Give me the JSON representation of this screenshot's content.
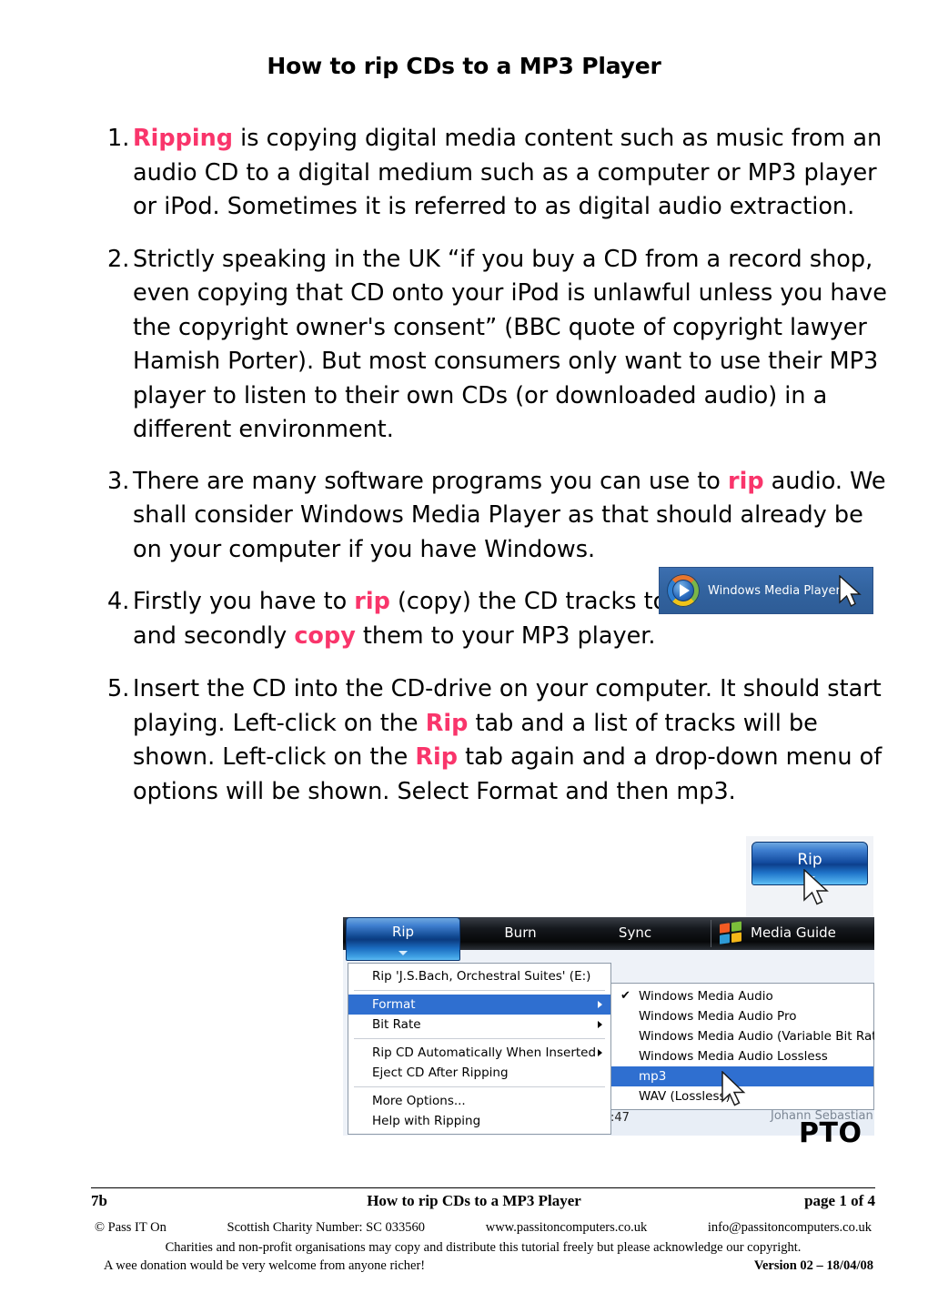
{
  "document": {
    "title": "How to rip CDs to a MP3 Player",
    "accent_pink": "#f9356b"
  },
  "items": [
    {
      "num": "1.",
      "pre": "",
      "emph": "Ripping",
      "post": " is copying digital media content such as music from an audio CD to a digital medium such as a computer or MP3 player or iPod. Sometimes it is referred to as digital audio extraction."
    },
    {
      "num": "2.",
      "text": "Strictly speaking in the UK “if you buy a CD from a record shop, even copying that CD onto your iPod is unlawful unless you have the copyright owner's consent” (BBC quote of copyright lawyer Hamish Porter). But most consumers only want to use their MP3 player to listen to their own CDs (or downloaded audio) in a different environment."
    },
    {
      "num": "3.",
      "pre": "There are many software programs you can use to ",
      "emph": "rip",
      "post": " audio. We shall consider Windows Media Player as that should already be on your computer if you have Windows."
    },
    {
      "num": "4.",
      "pre": "Firstly you have to ",
      "emph": "rip",
      "mid": " (copy) the CD tracks to your computer and secondly ",
      "emph2": "copy",
      "post": " them to your MP3 player."
    },
    {
      "num": "5.",
      "pre": "Insert the CD into the CD-drive on your computer. It should start playing. Left-click on the ",
      "emph": "Rip",
      "mid": " tab and a list of tracks will be shown. Left-click on the ",
      "emph2": "Rip",
      "post": " tab again and a drop-down menu of options will be shown. Select Format and then mp3."
    }
  ],
  "wmp_shortcut": {
    "label": "Windows Media Player",
    "background": "#33659f"
  },
  "rip_tab_shot": {
    "label": "Rip"
  },
  "wmp_window": {
    "tabs": [
      {
        "label": "Rip",
        "selected": true
      },
      {
        "label": "Burn",
        "selected": false
      },
      {
        "label": "Sync",
        "selected": false
      },
      {
        "label": "Media Guide",
        "selected": false
      }
    ],
    "menu": [
      {
        "label": "Rip 'J.S.Bach, Orchestral Suites' (E:)",
        "submenu": false,
        "selected": false
      },
      {
        "separator": true
      },
      {
        "label": "Format",
        "submenu": true,
        "selected": true
      },
      {
        "label": "Bit Rate",
        "submenu": true,
        "selected": false
      },
      {
        "separator": true
      },
      {
        "label": "Rip CD Automatically When Inserted",
        "submenu": true,
        "selected": false
      },
      {
        "label": "Eject CD After Ripping",
        "submenu": false,
        "selected": false
      },
      {
        "separator": true
      },
      {
        "label": "More Options...",
        "submenu": false,
        "selected": false
      },
      {
        "label": "Help with Ripping",
        "submenu": false,
        "selected": false
      }
    ],
    "submenu": [
      {
        "label": "Windows Media Audio",
        "checked": true,
        "selected": false
      },
      {
        "label": "Windows Media Audio Pro",
        "checked": false,
        "selected": false
      },
      {
        "label": "Windows Media Audio (Variable Bit Rate)",
        "checked": false,
        "selected": false
      },
      {
        "label": "Windows Media Audio Lossless",
        "checked": false,
        "selected": false
      },
      {
        "label": "mp3",
        "checked": false,
        "selected": true
      },
      {
        "label": "WAV (Lossless)",
        "checked": false,
        "selected": false
      }
    ],
    "checkmark": "✔",
    "track_time": ":47",
    "artist_ghost": "Johann Sebastian"
  },
  "pto": "PTO",
  "footer": {
    "code": "7b",
    "title": "How to rip CDs to a MP3 Player",
    "page": "page 1 of 4",
    "copyright": "© Pass IT On",
    "charity": "Scottish Charity Number: SC 033560",
    "website": "www.passitoncomputers.co.uk",
    "email": "info@passitoncomputers.co.uk",
    "permission": "Charities and non-profit organisations may copy and distribute this tutorial freely but please acknowledge our copyright.",
    "donation": "A wee donation would be very welcome from anyone richer!",
    "version": "Version 02 – 18/04/08"
  }
}
